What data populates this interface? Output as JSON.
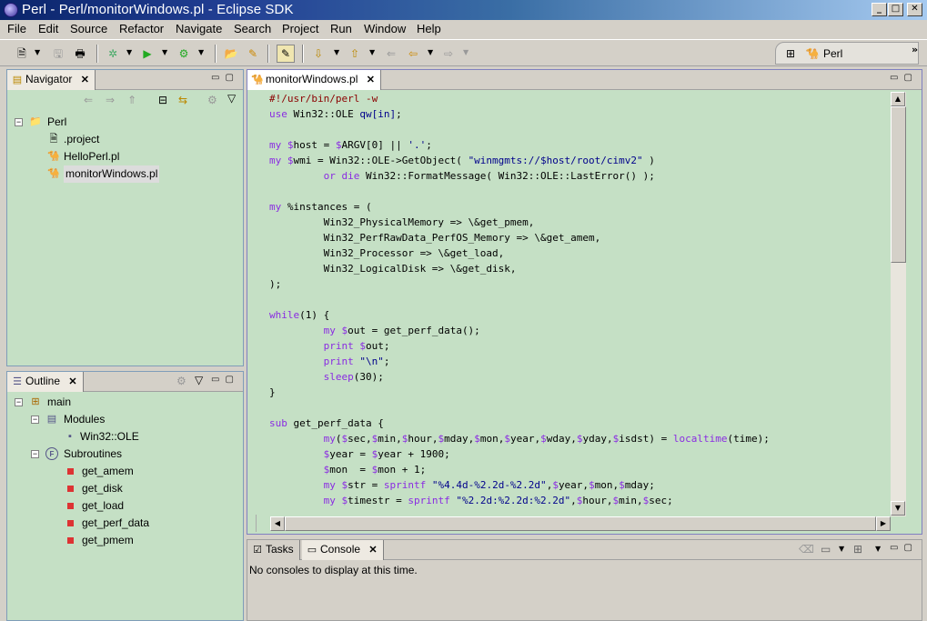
{
  "window": {
    "title": "Perl - Perl/monitorWindows.pl - Eclipse SDK"
  },
  "menu": [
    "File",
    "Edit",
    "Source",
    "Refactor",
    "Navigate",
    "Search",
    "Project",
    "Run",
    "Window",
    "Help"
  ],
  "perspective": {
    "label": "Perl"
  },
  "navigator": {
    "tab": "Navigator",
    "project": "Perl",
    "items": [
      ".project",
      "HelloPerl.pl",
      "monitorWindows.pl"
    ]
  },
  "outline": {
    "tab": "Outline",
    "root": "main",
    "modules_label": "Modules",
    "module": "Win32::OLE",
    "subs_label": "Subroutines",
    "subs": [
      "get_amem",
      "get_disk",
      "get_load",
      "get_perf_data",
      "get_pmem"
    ]
  },
  "editor": {
    "tab": "monitorWindows.pl",
    "lines": [
      "#!/usr/bin/perl -w",
      "use Win32::OLE qw[in];",
      "",
      "my $host = $ARGV[0] || '.';",
      "my $wmi = Win32::OLE->GetObject( \"winmgmts://$host/root/cimv2\" )",
      "         or die Win32::FormatMessage( Win32::OLE::LastError() );",
      "",
      "my %instances = (",
      "         Win32_PhysicalMemory => \\&get_pmem,",
      "         Win32_PerfRawData_PerfOS_Memory => \\&get_amem,",
      "         Win32_Processor => \\&get_load,",
      "         Win32_LogicalDisk => \\&get_disk,",
      ");",
      "",
      "while(1) {",
      "         my $out = get_perf_data();",
      "         print $out;",
      "         print \"\\n\";",
      "         sleep(30);",
      "}",
      "",
      "sub get_perf_data {",
      "         my($sec,$min,$hour,$mday,$mon,$year,$wday,$yday,$isdst) = localtime(time);",
      "         $year = $year + 1900;",
      "         $mon  = $mon + 1;",
      "         my $str = sprintf \"%4.4d-%2.2d-%2.2d\",$year,$mon,$mday;",
      "         my $timestr = sprintf \"%2.2d:%2.2d:%2.2d\",$hour,$min,$sec;"
    ]
  },
  "bottom": {
    "tabs": [
      "Tasks",
      "Console"
    ],
    "console_message": "No consoles to display at this time."
  },
  "colors": {
    "view_bg": "#c5e0c5",
    "keyword": "#8a2be2",
    "string": "#00008b"
  }
}
